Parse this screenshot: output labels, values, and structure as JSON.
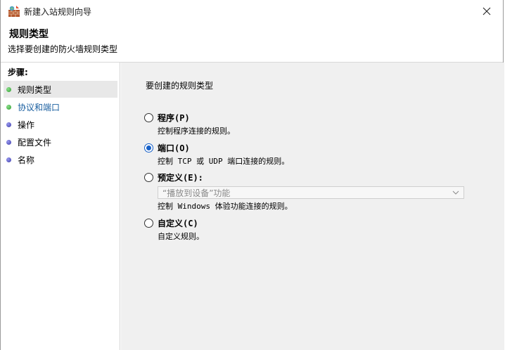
{
  "window": {
    "title": "新建入站规则向导",
    "icons": {
      "app": "firewall-app-icon",
      "close": "close-icon"
    }
  },
  "header": {
    "title": "规则类型",
    "subtitle": "选择要创建的防火墙规则类型"
  },
  "steps": {
    "title": "步骤:",
    "items": [
      {
        "label": "规则类型",
        "status": "green",
        "active": true
      },
      {
        "label": "协议和端口",
        "status": "green",
        "active": false,
        "link": true
      },
      {
        "label": "操作",
        "status": "blue",
        "active": false
      },
      {
        "label": "配置文件",
        "status": "blue",
        "active": false
      },
      {
        "label": "名称",
        "status": "blue",
        "active": false
      }
    ]
  },
  "main": {
    "prompt": "要创建的规则类型",
    "options": [
      {
        "label": "程序(P)",
        "desc": "控制程序连接的规则。",
        "checked": false
      },
      {
        "label": "端口(O)",
        "desc": "控制 TCP 或 UDP 端口连接的规则。",
        "checked": true
      },
      {
        "label": "预定义(E):",
        "select_value": "“播放到设备”功能",
        "desc": "控制 Windows 体验功能连接的规则。",
        "checked": false
      },
      {
        "label": "自定义(C)",
        "desc": "自定义规则。",
        "checked": false
      }
    ]
  },
  "colors": {
    "accent": "#1660c8",
    "content_bg": "#f0f0f0",
    "step_active_bg": "#e8e8e8",
    "link": "#1a5fa0"
  }
}
